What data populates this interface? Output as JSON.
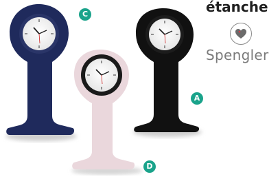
{
  "headline": "étanche",
  "brand": {
    "name": "Spengler",
    "logo_icon": "heart-in-circle-icon"
  },
  "variants": [
    {
      "badge": "C",
      "color_name": "navy",
      "color": "#1f2a5c"
    },
    {
      "badge": "A",
      "color_name": "black",
      "color": "#111111"
    },
    {
      "badge": "D",
      "color_name": "pink",
      "color": "#ead7dc"
    }
  ],
  "badge_color": "#1aa38b"
}
